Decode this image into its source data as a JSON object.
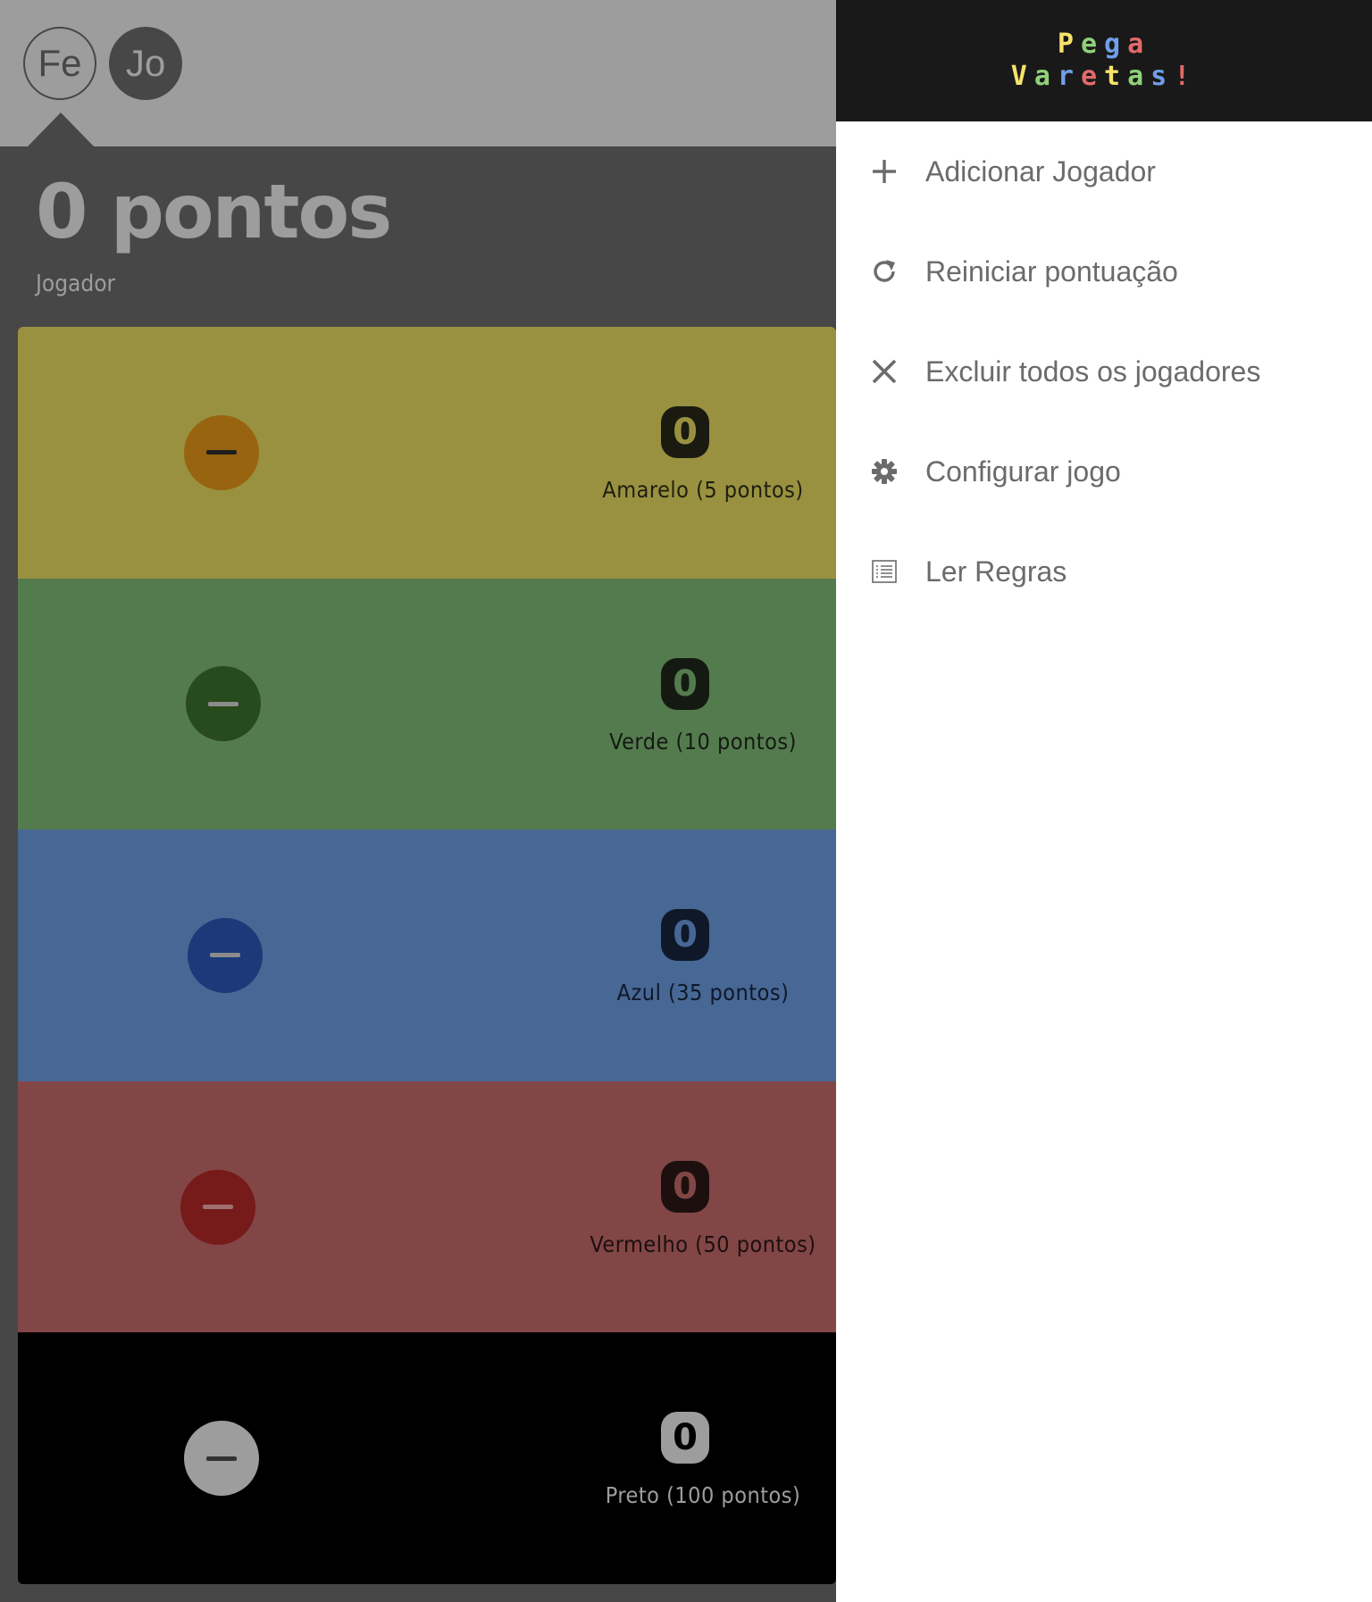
{
  "players": {
    "avatars": [
      {
        "initials": "Fe",
        "selected": true
      },
      {
        "initials": "Jo",
        "selected": false
      }
    ]
  },
  "score": {
    "title": "0 pontos",
    "player_label": "Jogador"
  },
  "sticks": [
    {
      "label": "Amarelo (5 pontos)",
      "count": "0",
      "row_color": "#999140",
      "button_color": "#98640f",
      "button_bar": "#1e1e1e",
      "count_bg": "#1a1a10",
      "count_fg": "#999140",
      "label_color": "#1e1e10"
    },
    {
      "label": "Verde (10 pontos)",
      "count": "0",
      "row_color": "#547b4e",
      "button_color": "#274b1c",
      "button_bar": "#8c8c8c",
      "count_bg": "#141a12",
      "count_fg": "#547b4e",
      "label_color": "#141a12"
    },
    {
      "label": "Azul (35 pontos)",
      "count": "0",
      "row_color": "#476795",
      "button_color": "#1c3a79",
      "button_bar": "#8c8c8c",
      "count_bg": "#0f1828",
      "count_fg": "#476795",
      "label_color": "#0f1828"
    },
    {
      "label": "Vermelho (50 pontos)",
      "count": "0",
      "row_color": "#824646",
      "button_color": "#761a1a",
      "button_bar": "#a07070",
      "count_bg": "#1e0f0f",
      "count_fg": "#824646",
      "label_color": "#1e0f0f"
    },
    {
      "label": "Preto (100 pontos)",
      "count": "0",
      "row_color": "#000000",
      "button_color": "#9d9d9d",
      "button_bar": "#333333",
      "count_bg": "#9d9d9d",
      "count_fg": "#000000",
      "label_color": "#9d9d9d"
    }
  ],
  "drawer": {
    "logo_line1": [
      "P",
      "e",
      "g",
      "a"
    ],
    "logo_line2": [
      "V",
      "a",
      "r",
      "e",
      "t",
      "a",
      "s",
      "!"
    ],
    "logo_colors": [
      "#f5e36b",
      "#8fd17a",
      "#6f9fe8",
      "#e26a6a"
    ],
    "menu": [
      {
        "label": "Adicionar Jogador",
        "icon": "plus-icon"
      },
      {
        "label": "Reiniciar pontuação",
        "icon": "refresh-icon"
      },
      {
        "label": "Excluir todos os jogadores",
        "icon": "close-icon"
      },
      {
        "label": "Configurar jogo",
        "icon": "gear-icon"
      },
      {
        "label": "Ler Regras",
        "icon": "list-icon"
      }
    ]
  }
}
